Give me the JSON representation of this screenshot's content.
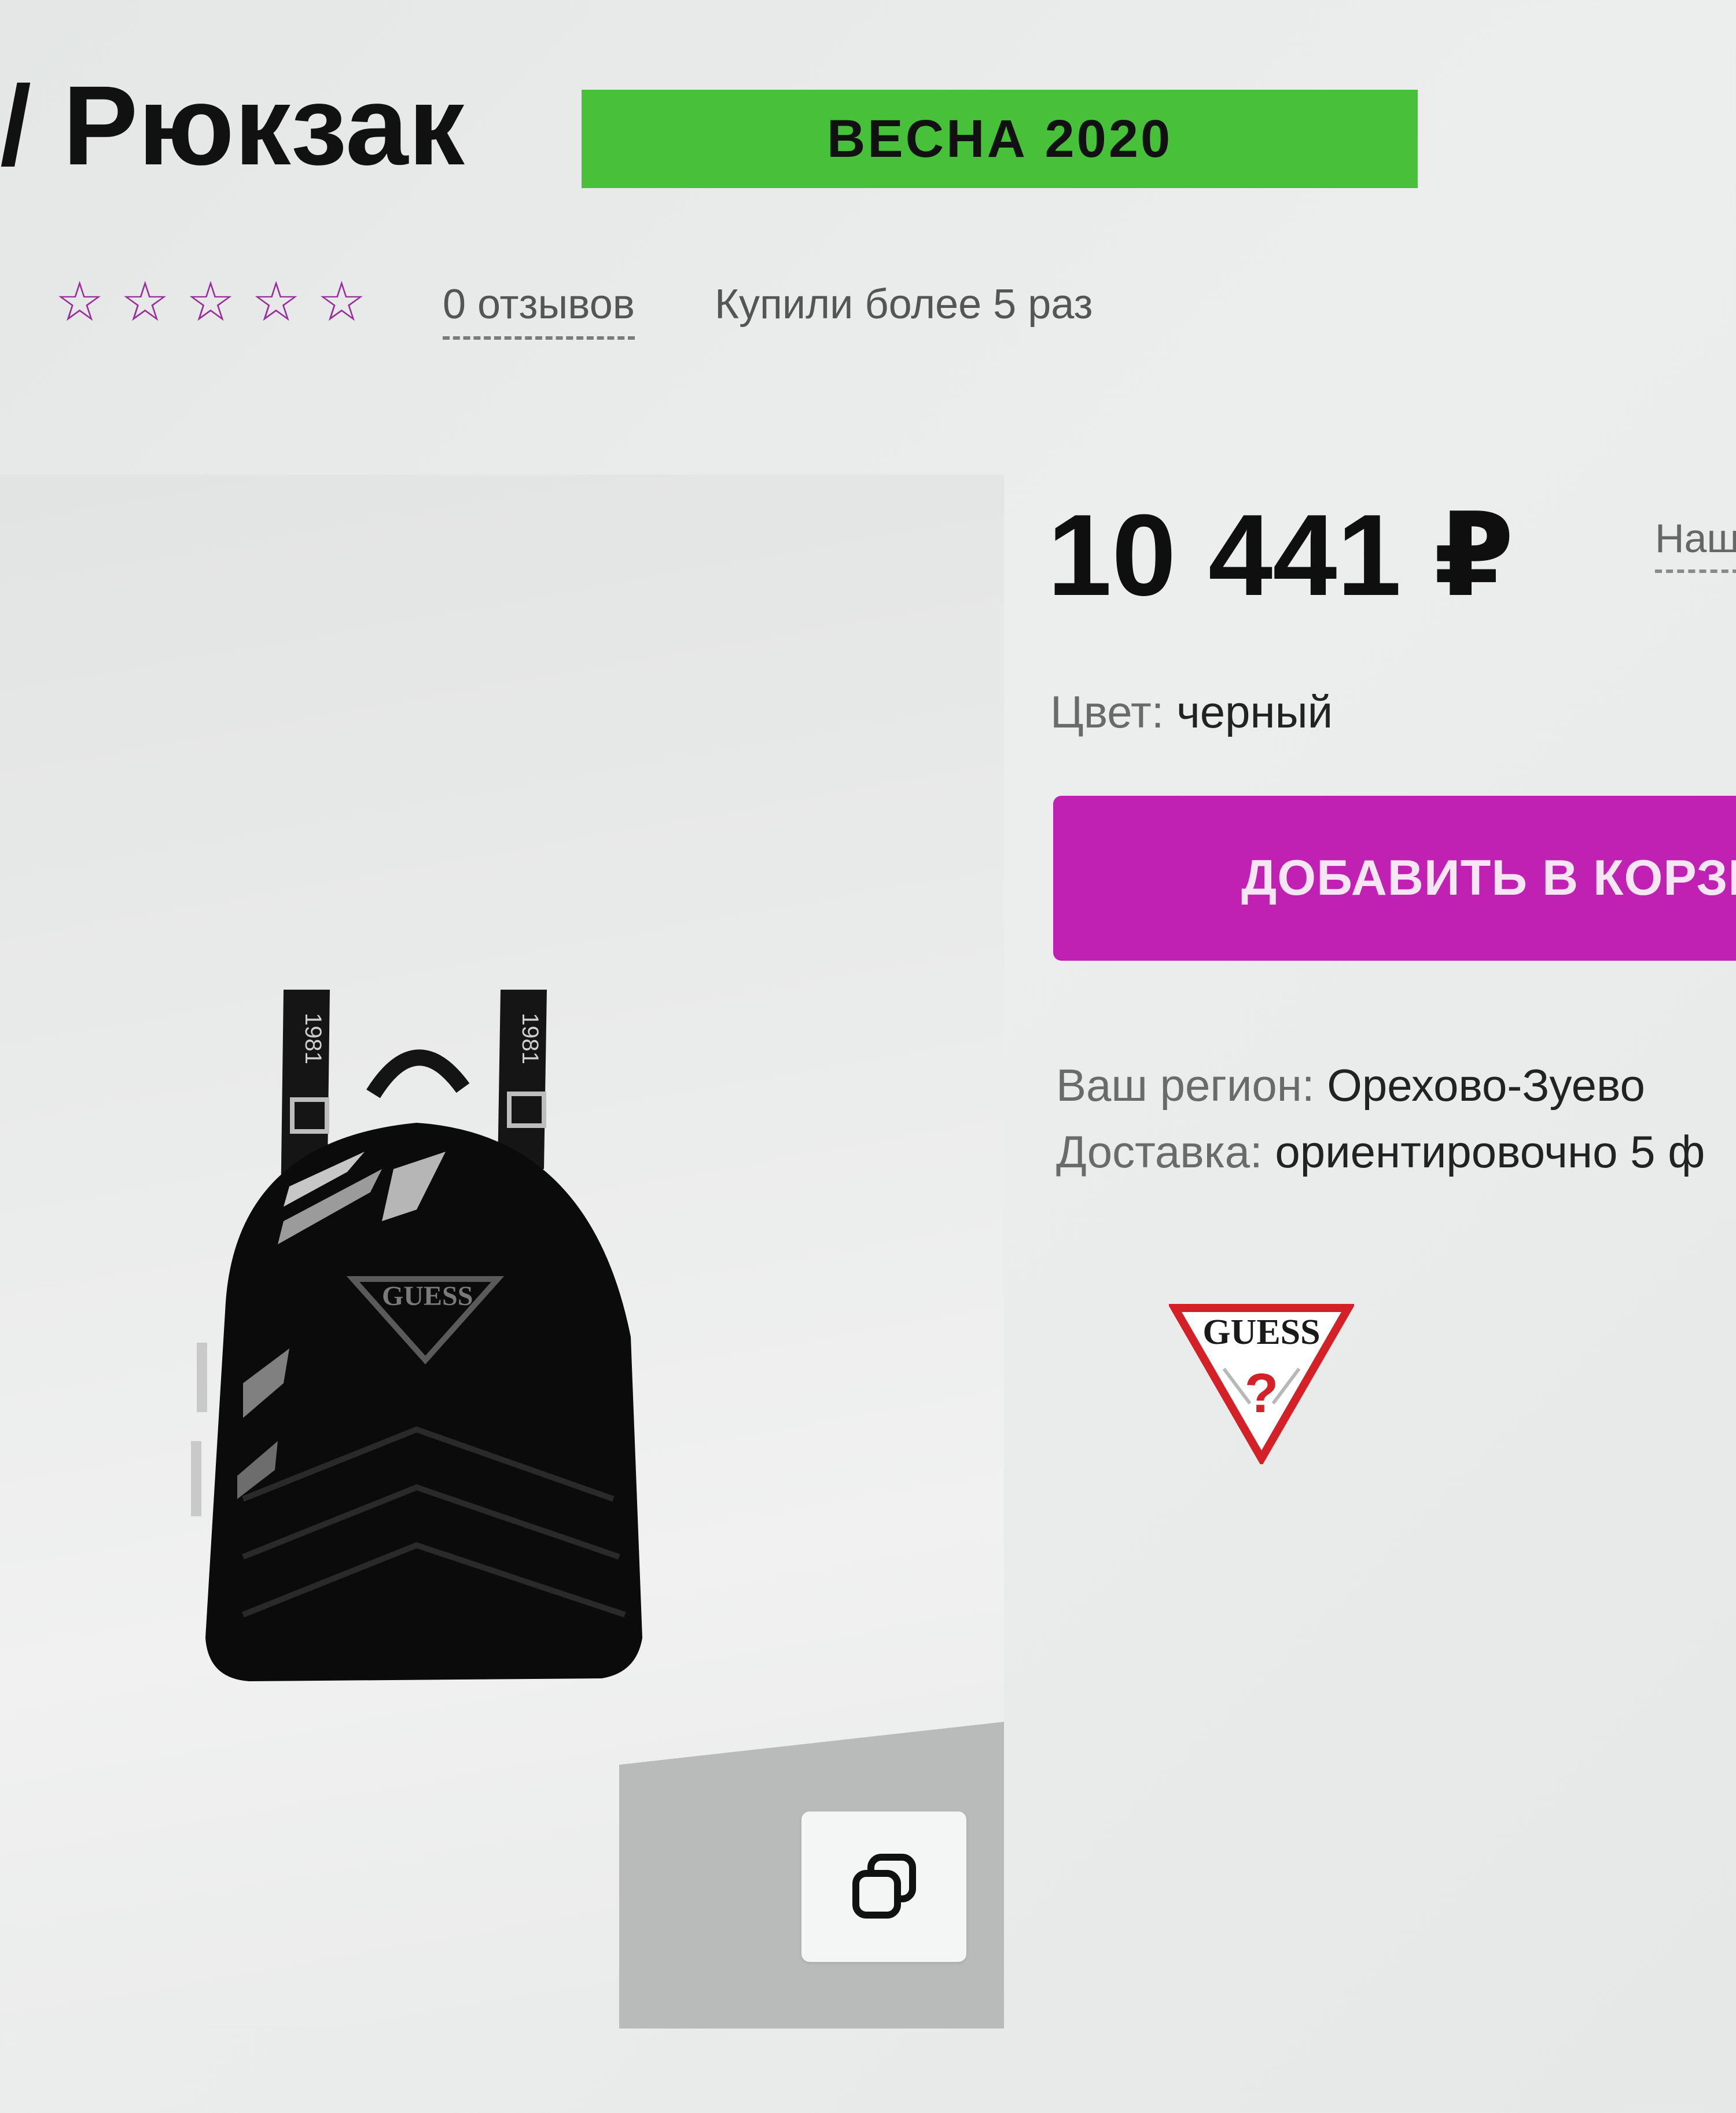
{
  "header": {
    "title": "/ Рюкзак",
    "badge": "ВЕСНА 2020"
  },
  "rating": {
    "stars_filled": 0,
    "stars_total": 5,
    "reviews_link": "0 отзывов",
    "bought_text": "Купили более 5 раз"
  },
  "product": {
    "price": "10 441 ₽",
    "price_side_link": "Наш",
    "color_label": "Цвет:",
    "color_value": "черный",
    "add_to_cart": "ДОБАВИТЬ В КОРЗИНУ",
    "region_label": "Ваш регион:",
    "region_value": "Орехово-Зуево",
    "delivery_label": "Доставка:",
    "delivery_value": "ориентировочно 5 ф"
  },
  "brand": {
    "logo_text": "GUESS"
  },
  "icons": {
    "star": "star-outline-icon",
    "copy": "copy-icon"
  },
  "colors": {
    "badge_green": "#47c13a",
    "button_magenta": "#c021b2",
    "star_purple": "#9a2c9c",
    "logo_red": "#d42027"
  }
}
